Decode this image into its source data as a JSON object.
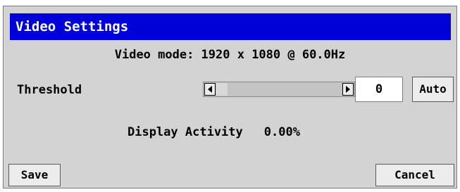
{
  "window": {
    "title": "Video Settings"
  },
  "video_mode": {
    "text": "Video mode: 1920 x 1080 @ 60.0Hz"
  },
  "threshold": {
    "label": "Threshold",
    "value": "0",
    "scroll_left_icon": "arrow-left-icon",
    "scroll_right_icon": "arrow-right-icon",
    "auto_label": "Auto"
  },
  "display_activity": {
    "label": "Display Activity",
    "value": "0.00%"
  },
  "footer": {
    "save_label": "Save",
    "cancel_label": "Cancel"
  },
  "colors": {
    "title_bar": "#0000d8",
    "window_bg": "#d3d3d3",
    "button_bg": "#ececec"
  }
}
